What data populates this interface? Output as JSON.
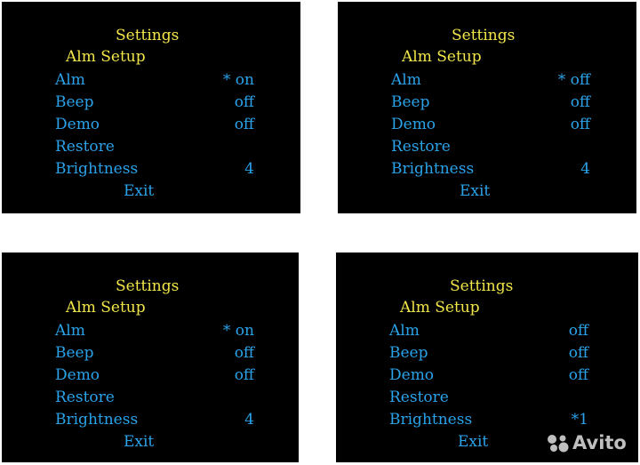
{
  "panels": [
    {
      "title": "Settings",
      "subtitle": "Alm Setup",
      "rows": [
        {
          "label": "Alm",
          "value": "* on"
        },
        {
          "label": "Beep",
          "value": "off"
        },
        {
          "label": "Demo",
          "value": "off"
        },
        {
          "label": "Restore",
          "value": ""
        },
        {
          "label": "Brightness",
          "value": "4"
        }
      ],
      "exit": "Exit"
    },
    {
      "title": "Settings",
      "subtitle": "Alm Setup",
      "rows": [
        {
          "label": "Alm",
          "value": "* off"
        },
        {
          "label": "Beep",
          "value": "off"
        },
        {
          "label": "Demo",
          "value": "off"
        },
        {
          "label": "Restore",
          "value": ""
        },
        {
          "label": "Brightness",
          "value": "4"
        }
      ],
      "exit": "Exit"
    },
    {
      "title": "Settings",
      "subtitle": "Alm Setup",
      "rows": [
        {
          "label": "Alm",
          "value": "* on"
        },
        {
          "label": "Beep",
          "value": "off"
        },
        {
          "label": "Demo",
          "value": "off"
        },
        {
          "label": "Restore",
          "value": ""
        },
        {
          "label": "Brightness",
          "value": "4"
        }
      ],
      "exit": "Exit"
    },
    {
      "title": "Settings",
      "subtitle": "Alm Setup",
      "rows": [
        {
          "label": "Alm",
          "value": "off"
        },
        {
          "label": "Beep",
          "value": "off"
        },
        {
          "label": "Demo",
          "value": "off"
        },
        {
          "label": "Restore",
          "value": ""
        },
        {
          "label": "Brightness",
          "value": "*1"
        }
      ],
      "exit": "Exit"
    }
  ],
  "watermark": {
    "text": "Avito",
    "icon": "avito-logo-icon"
  },
  "colors": {
    "background": "#000000",
    "heading": "#f2e64a",
    "item": "#2aa3ea"
  }
}
